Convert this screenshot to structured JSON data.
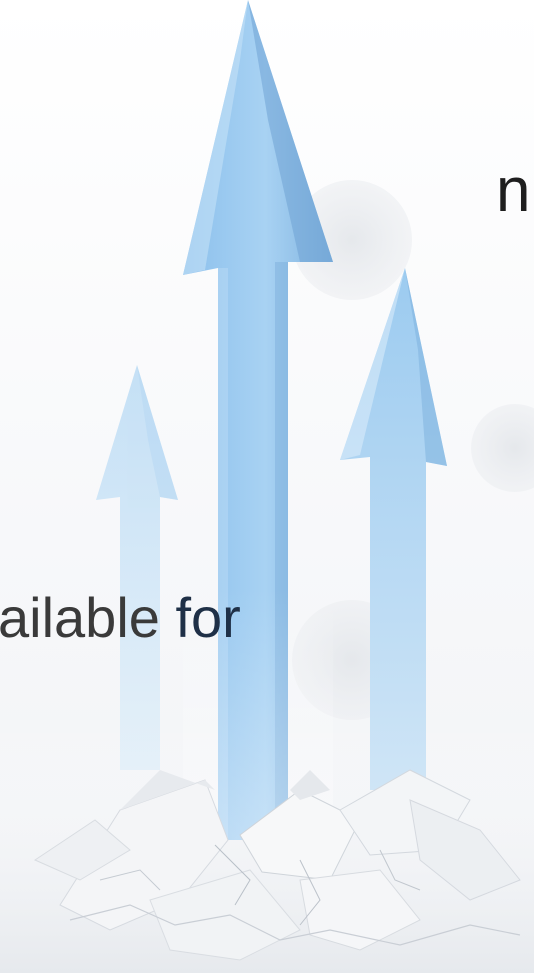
{
  "slide": {
    "top_fragment": "n",
    "mid_fragment_a": "ailable ",
    "mid_fragment_b": "for"
  },
  "colors": {
    "arrow_main": "#9ccbf0",
    "arrow_shade": "#6fa8d8",
    "arrow_light": "#c7e1f6",
    "bubble": "#e9ebee",
    "rubble": "#f2f4f6",
    "rubble_shadow": "#c9ced5",
    "text": "#3a3a3a",
    "text_accent": "#1f3047"
  },
  "icons": [
    "growth-arrows-illustration",
    "broken-ground-illustration"
  ]
}
